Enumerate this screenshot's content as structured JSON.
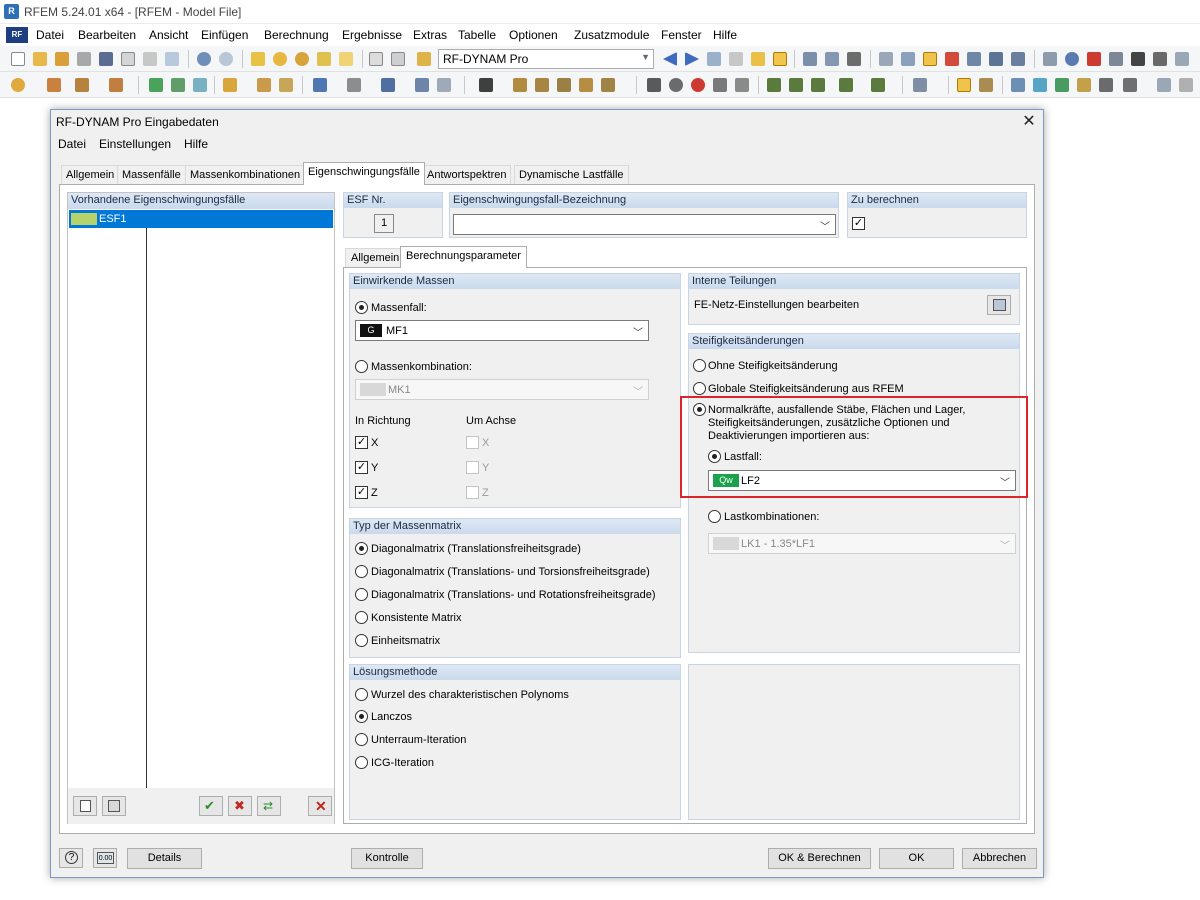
{
  "app": {
    "title": "RFEM 5.24.01 x64 - [RFEM - Model File]",
    "menu": [
      "Datei",
      "Bearbeiten",
      "Ansicht",
      "Einfügen",
      "Berechnung",
      "Ergebnisse",
      "Extras",
      "Tabelle",
      "Optionen",
      "Zusatzmodule",
      "Fenster",
      "Hilfe"
    ],
    "module_combo": "RF-DYNAM Pro"
  },
  "dialog": {
    "title": "RF-DYNAM Pro Eingabedaten",
    "menu": [
      "Datei",
      "Einstellungen",
      "Hilfe"
    ],
    "tabs": [
      "Allgemein",
      "Massenfälle",
      "Massenkombinationen",
      "Eigenschwingungsfälle",
      "Antwortspektren",
      "Dynamische Lastfälle"
    ],
    "active_tab": "Eigenschwingungsfälle",
    "list": {
      "header": "Vorhandene Eigenschwingungsfälle",
      "items": [
        {
          "label": "ESF1",
          "color": "#b5d36a"
        }
      ]
    },
    "esf_nr": {
      "label": "ESF Nr.",
      "value": "1"
    },
    "designation": {
      "label": "Eigenschwingungsfall-Bezeichnung",
      "value": ""
    },
    "calculate": {
      "label": "Zu berechnen",
      "checked": true
    },
    "subtabs": [
      "Allgemein",
      "Berechnungsparameter"
    ],
    "active_subtab": "Berechnungsparameter",
    "masses": {
      "header": "Einwirkende Massen",
      "massenfall": {
        "label": "Massenfall:",
        "selected": true,
        "badge": "G",
        "value": "MF1"
      },
      "massenkombination": {
        "label": "Massenkombination:",
        "selected": false,
        "value": "MK1"
      },
      "direction_label": "In Richtung",
      "axis_label": "Um Achse",
      "directions": [
        {
          "axis": "X",
          "checked": true
        },
        {
          "axis": "Y",
          "checked": true
        },
        {
          "axis": "Z",
          "checked": true
        }
      ],
      "rotations": [
        {
          "axis": "X",
          "checked": false
        },
        {
          "axis": "Y",
          "checked": false
        },
        {
          "axis": "Z",
          "checked": false
        }
      ]
    },
    "mass_matrix": {
      "header": "Typ der Massenmatrix",
      "options": [
        {
          "label": "Diagonalmatrix (Translationsfreiheitsgrade)",
          "selected": true
        },
        {
          "label": "Diagonalmatrix (Translations- und Torsionsfreiheitsgrade)",
          "selected": false
        },
        {
          "label": "Diagonalmatrix (Translations- und Rotationsfreiheitsgrade)",
          "selected": false
        },
        {
          "label": "Konsistente Matrix",
          "selected": false
        },
        {
          "label": "Einheitsmatrix",
          "selected": false
        }
      ]
    },
    "solver": {
      "header": "Lösungsmethode",
      "options": [
        {
          "label": "Wurzel des charakteristischen Polynoms",
          "selected": false
        },
        {
          "label": "Lanczos",
          "selected": true
        },
        {
          "label": "Unterraum-Iteration",
          "selected": false
        },
        {
          "label": "ICG-Iteration",
          "selected": false
        }
      ]
    },
    "internal_divisions": {
      "header": "Interne Teilungen",
      "label": "FE-Netz-Einstellungen bearbeiten"
    },
    "stiffness": {
      "header": "Steifigkeitsänderungen",
      "opt_none": "Ohne Steifigkeitsänderung",
      "opt_global": "Globale Steifigkeitsänderung aus RFEM",
      "opt_import": "Normalkräfte, ausfallende Stäbe, Flächen und Lager, Steifigkeitsänderungen, zusätzliche Optionen und Deaktivierungen importieren aus:",
      "selected": "import",
      "lastfall": {
        "label": "Lastfall:",
        "selected": true,
        "badge": "Qw",
        "badge_color": "#1aa34a",
        "value": "LF2"
      },
      "lastkombi": {
        "label": "Lastkombinationen:",
        "selected": false,
        "value": "LK1 - 1.35*LF1"
      }
    },
    "buttons": {
      "details": "Details",
      "kontrolle": "Kontrolle",
      "ok_calc": "OK & Berechnen",
      "ok": "OK",
      "cancel": "Abbrechen"
    }
  }
}
